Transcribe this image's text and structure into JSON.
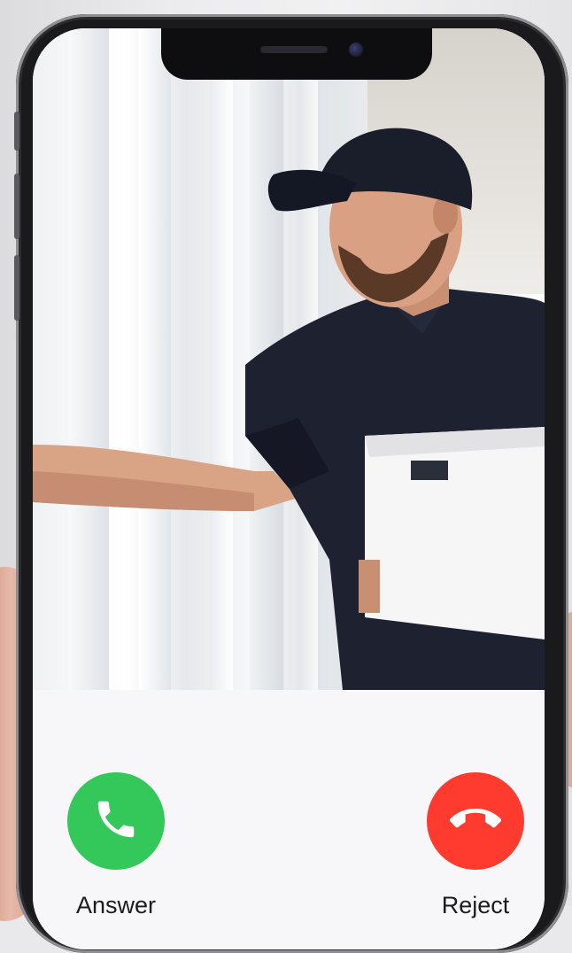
{
  "call": {
    "answer_label": "Answer",
    "reject_label": "Reject"
  },
  "icons": {
    "answer": "phone-icon",
    "reject": "phone-hangup-icon"
  },
  "colors": {
    "answer": "#34c759",
    "reject": "#ff3b30",
    "panel": "#f7f7f9",
    "frame": "#1a1a1c"
  }
}
